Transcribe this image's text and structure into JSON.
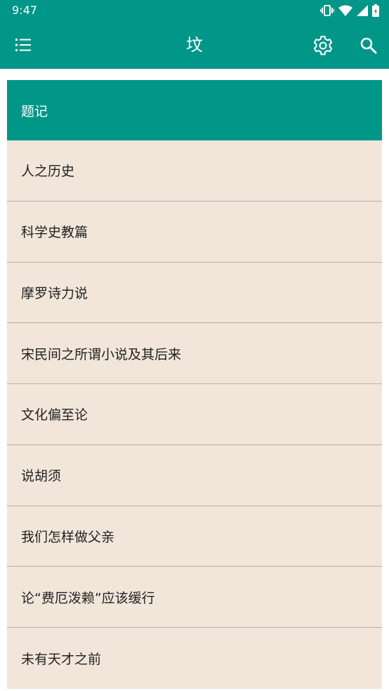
{
  "status_bar": {
    "time": "9:47",
    "icons": [
      "vibrate-icon",
      "wifi-icon",
      "signal-icon",
      "battery-icon"
    ]
  },
  "app_bar": {
    "title": "坟",
    "menu_icon": "list-icon",
    "settings_icon": "gear-icon",
    "search_icon": "search-icon"
  },
  "list": {
    "header": "题记",
    "items": [
      "人之历史",
      "科学史教篇",
      "摩罗诗力说",
      "宋民间之所谓小说及其后来",
      "文化偏至论",
      "说胡须",
      "我们怎样做父亲",
      "论“费厄泼赖”应该缓行",
      "未有天才之前"
    ]
  },
  "colors": {
    "primary": "#009688",
    "item_background": "#f2e6da",
    "divider": "#b8aea6",
    "item_text": "#222222"
  }
}
